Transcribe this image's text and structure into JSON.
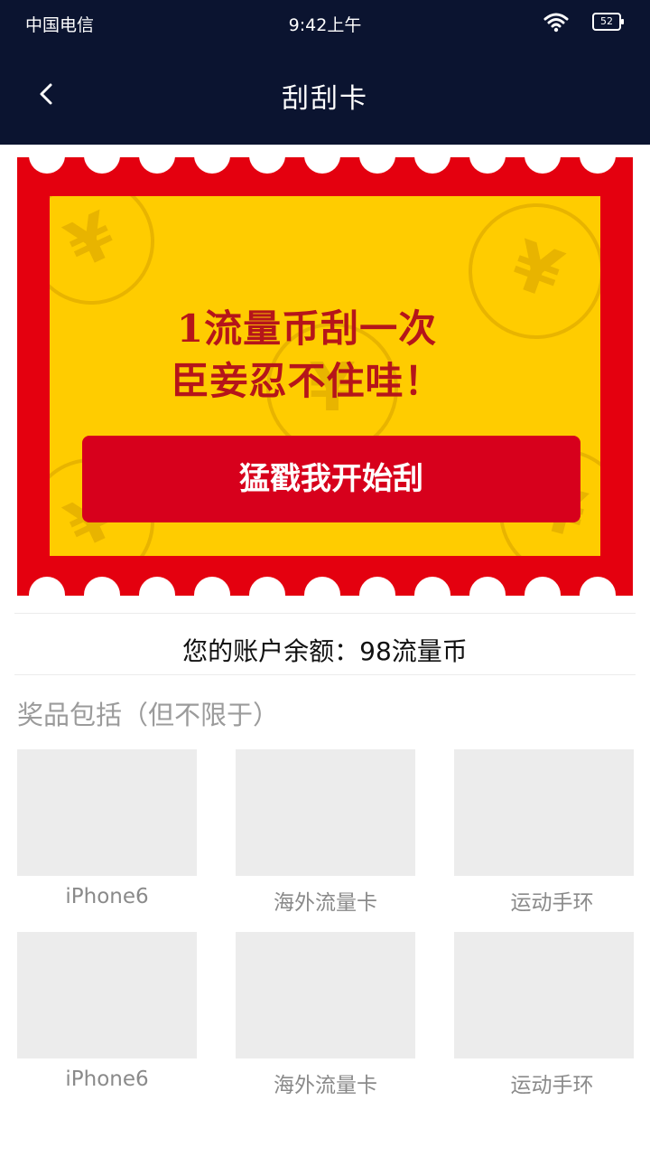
{
  "status": {
    "carrier": "中国电信",
    "time": "9:42上午",
    "battery": "52"
  },
  "header": {
    "title": "刮刮卡",
    "back_icon": "chevron-left-icon"
  },
  "ticket": {
    "line1": "1流量币刮一次",
    "line2": "臣妾忍不住哇！",
    "button": "猛戳我开始刮",
    "coin_symbol": "¥",
    "colors": {
      "border": "#e4000f",
      "panel": "#ffcc00",
      "button": "#d7001c"
    }
  },
  "balance": {
    "text": "您的账户余额：98流量币"
  },
  "prizes": {
    "heading": "奖品包括（但不限于）",
    "items": [
      {
        "label": "iPhone6"
      },
      {
        "label": "海外流量卡"
      },
      {
        "label": "运动手环"
      },
      {
        "label": "iPhone6"
      },
      {
        "label": "海外流量卡"
      },
      {
        "label": "运动手环"
      }
    ]
  }
}
